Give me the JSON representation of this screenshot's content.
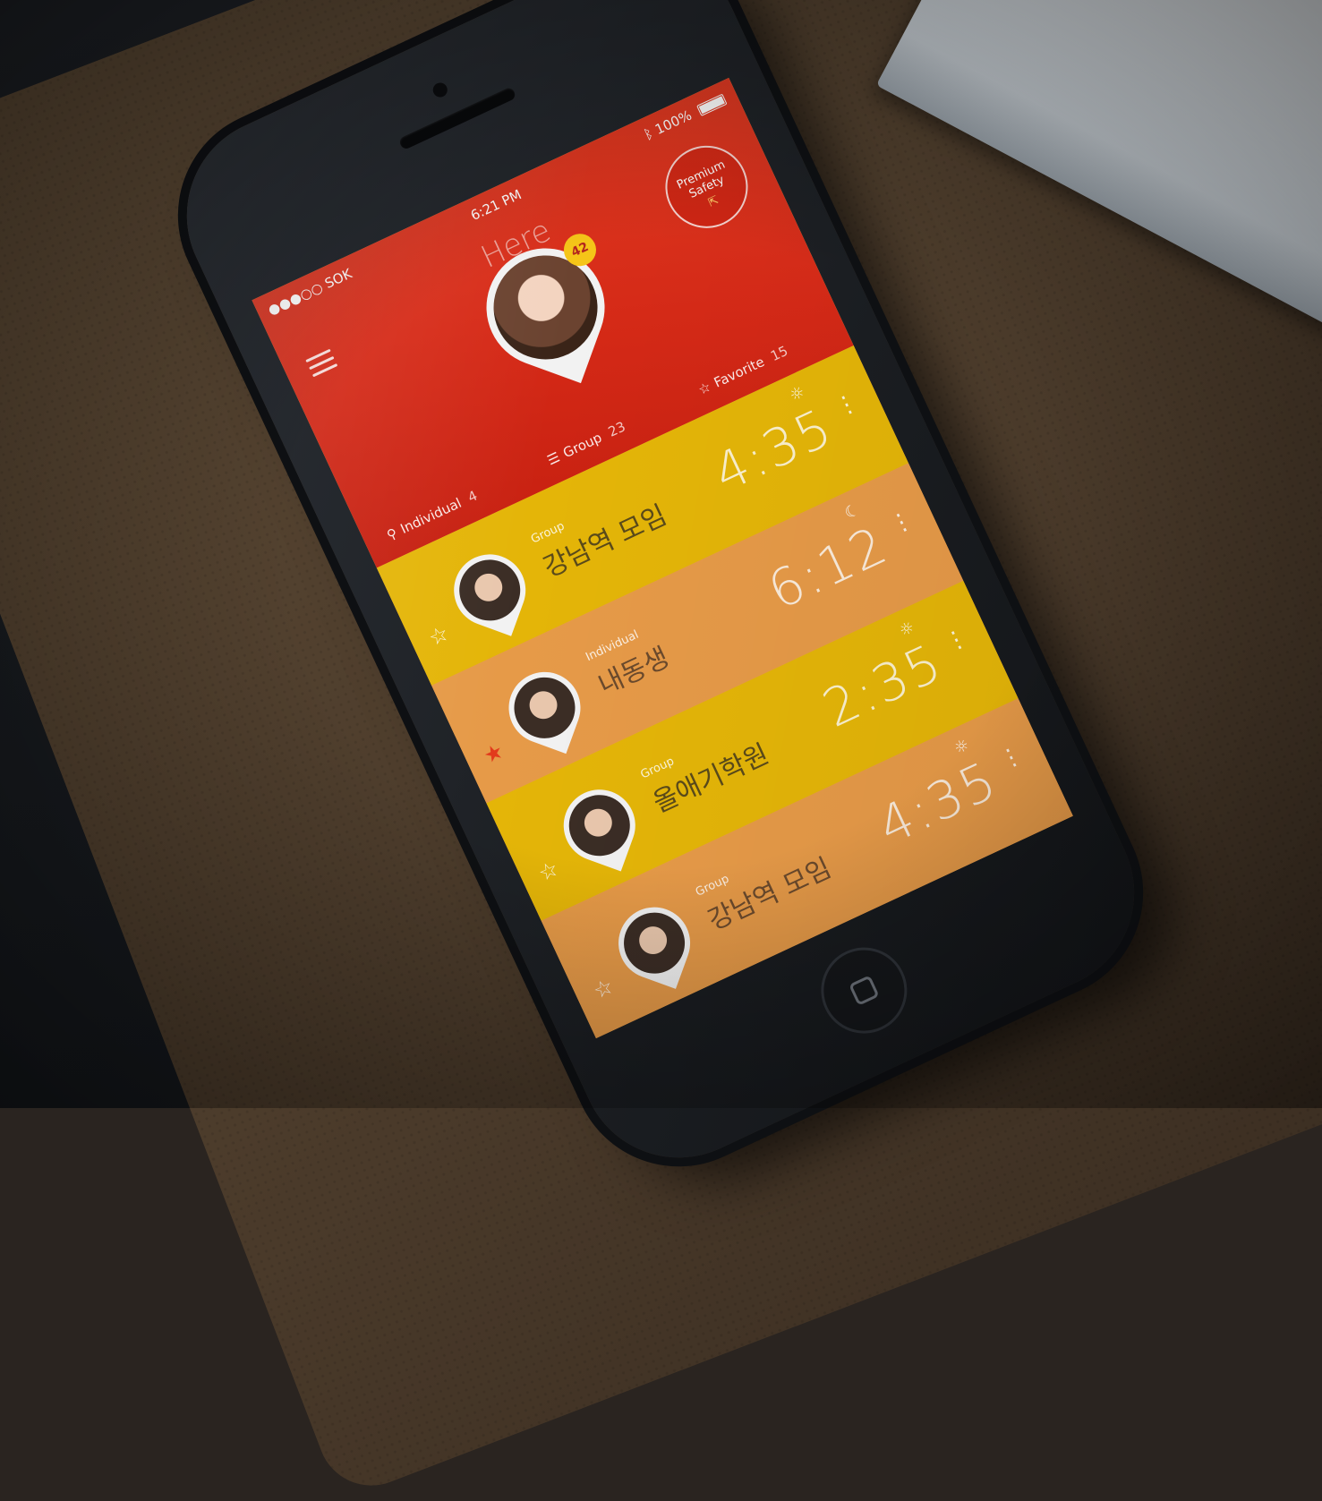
{
  "status_bar": {
    "carrier": "●●●○○ SOK",
    "wifi_icon": "wifi-icon",
    "time": "6:21 PM",
    "bluetooth_icon": "bluetooth-icon",
    "battery": "100%"
  },
  "header": {
    "title": "Here",
    "menu_icon": "hamburger-menu-icon",
    "premium_button": {
      "line1": "Premium",
      "line2": "Safety"
    },
    "profile_badge": "42",
    "stats": {
      "individual": {
        "label": "Individual",
        "count": "4"
      },
      "group": {
        "label": "Group",
        "count": "23"
      },
      "favorite": {
        "label": "Favorite",
        "count": "15"
      }
    }
  },
  "list": [
    {
      "type": "Group",
      "name": "강남역 모임",
      "time": "4:35",
      "weather": "☼",
      "favorite": false,
      "color": "#e4b508"
    },
    {
      "type": "Individual",
      "name": "내동생",
      "time": "6:12",
      "weather": "☾",
      "favorite": true,
      "color": "#e69a48"
    },
    {
      "type": "Group",
      "name": "올애기학원",
      "time": "2:35",
      "weather": "☼",
      "favorite": false,
      "color": "#e4b508"
    },
    {
      "type": "Group",
      "name": "강남역 모임",
      "time": "4:35",
      "weather": "☼",
      "favorite": false,
      "color": "#e69a48"
    }
  ],
  "colors": {
    "header_red": "#d62a17",
    "row_yellow": "#e4b508",
    "row_orange": "#e69a48",
    "favorite_active": "#e23a1c"
  }
}
